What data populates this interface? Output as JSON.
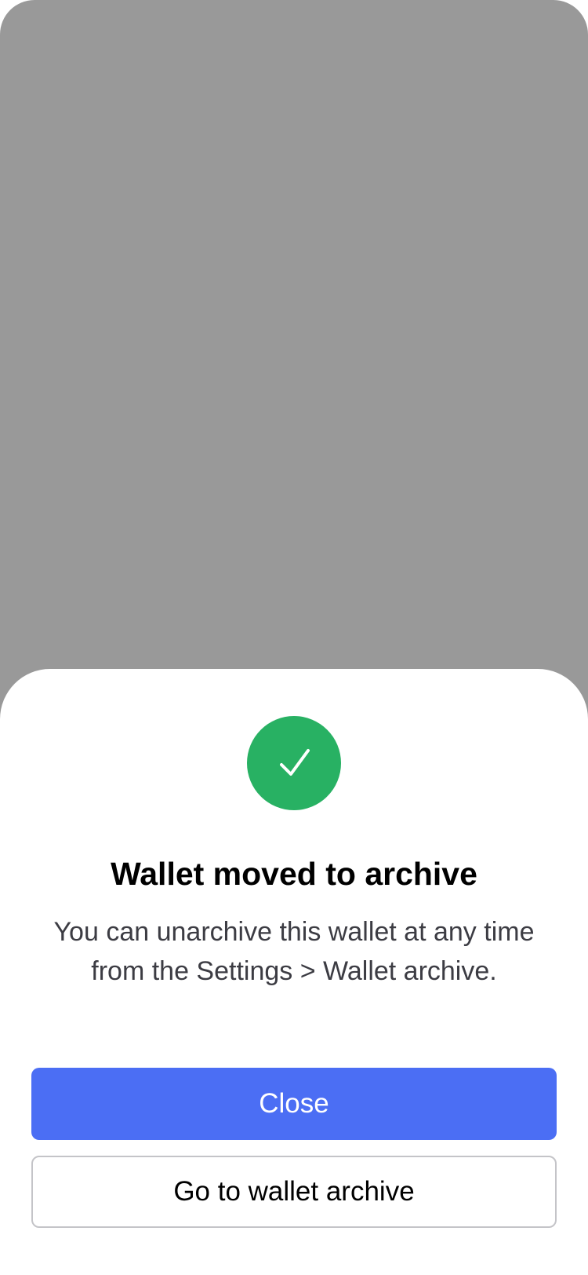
{
  "colors": {
    "backdrop": "#999999",
    "success": "#28b163",
    "primary": "#4b6ef4",
    "text_primary": "#000000",
    "text_secondary": "#3c3c43",
    "outline": "#c4c4c8"
  },
  "icon": "checkmark-icon",
  "dialog": {
    "title": "Wallet moved to archive",
    "description": "You can unarchive this wallet at any time from the Settings > Wallet archive.",
    "primary_button_label": "Close",
    "secondary_button_label": "Go to wallet archive"
  }
}
